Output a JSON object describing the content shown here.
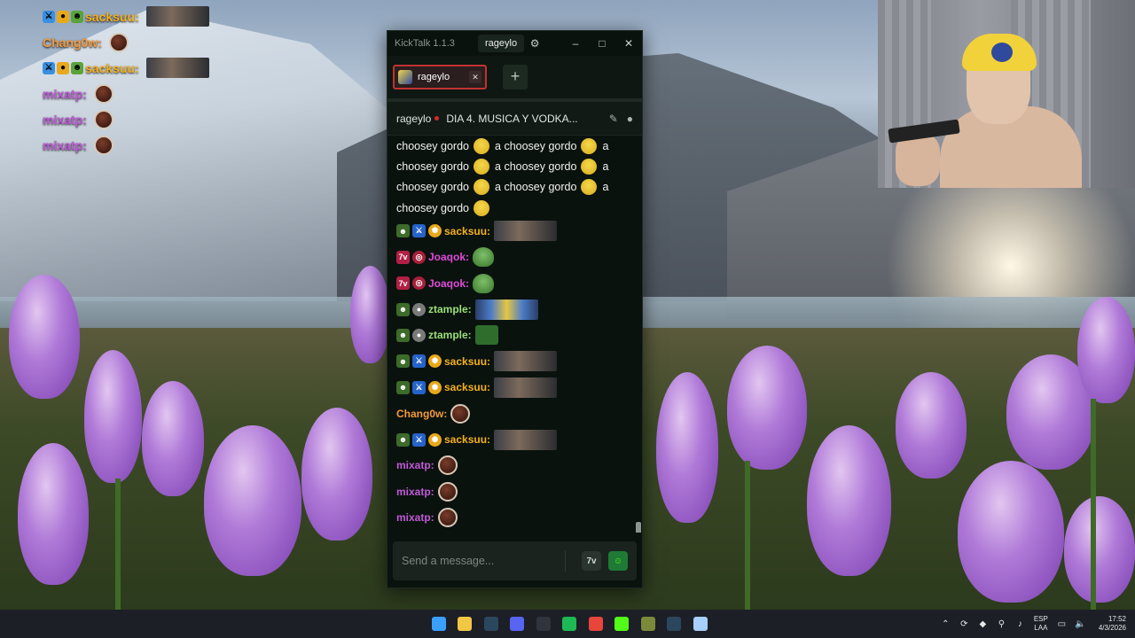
{
  "overlay_chat": [
    {
      "user": "sacksuu:",
      "color": "#f5b11c",
      "badges": [
        "sword",
        "coin",
        "robot"
      ],
      "emote": "image"
    },
    {
      "user": "Chang0w:",
      "color": "#f39a3b",
      "badges": [],
      "emote": "ball"
    },
    {
      "user": "sacksuu:",
      "color": "#f5b11c",
      "badges": [
        "sword",
        "coin",
        "robot"
      ],
      "emote": "image"
    },
    {
      "user": "mixatp:",
      "color": "#c05ad8",
      "badges": [],
      "emote": "ball"
    },
    {
      "user": "mixatp:",
      "color": "#c05ad8",
      "badges": [],
      "emote": "ball"
    },
    {
      "user": "mixatp:",
      "color": "#c05ad8",
      "badges": [],
      "emote": "ball"
    }
  ],
  "window": {
    "app_title": "KickTalk 1.1.3",
    "current_user": "rageylo",
    "settings_icon": "gear-icon",
    "minimize": "–",
    "maximize": "□",
    "close": "✕"
  },
  "tabs": [
    {
      "label": "rageylo",
      "close": "✕"
    }
  ],
  "add_tab_label": "+",
  "chat_header": {
    "channel": "rageylo",
    "stream_title": "DIA 4. MUSICA Y VODKA...",
    "icons": [
      "pin-icon",
      "user-icon"
    ]
  },
  "repeated_message": {
    "lines": [
      [
        "choosey gordo",
        "a choosey gordo",
        "a"
      ],
      [
        "choosey gordo",
        "a choosey gordo",
        "a"
      ],
      [
        "choosey gordo",
        "a choosey gordo",
        "a"
      ],
      [
        "choosey gordo"
      ]
    ]
  },
  "messages": [
    {
      "user": "sacksuu:",
      "color": "#f5b11c",
      "badges": [
        "green",
        "blue",
        "gold"
      ],
      "emote": "image"
    },
    {
      "user": "Joaqok:",
      "color": "#e04ad8",
      "badges": [
        "red",
        "pink"
      ],
      "emote": "frog"
    },
    {
      "user": "Joaqok:",
      "color": "#e04ad8",
      "badges": [
        "red",
        "pink"
      ],
      "emote": "frog"
    },
    {
      "user": "ztample:",
      "color": "#9be07a",
      "badges": [
        "green",
        "gray"
      ],
      "emote": "minions"
    },
    {
      "user": "ztample:",
      "color": "#9be07a",
      "badges": [
        "green",
        "gray"
      ],
      "emote": "box"
    },
    {
      "user": "sacksuu:",
      "color": "#f5b11c",
      "badges": [
        "green",
        "blue",
        "gold"
      ],
      "emote": "image"
    },
    {
      "user": "sacksuu:",
      "color": "#f5b11c",
      "badges": [
        "green",
        "blue",
        "gold"
      ],
      "emote": "image"
    },
    {
      "user": "Chang0w:",
      "color": "#f39a3b",
      "badges": [],
      "emote": "ball"
    },
    {
      "user": "sacksuu:",
      "color": "#f5b11c",
      "badges": [
        "green",
        "blue",
        "gold"
      ],
      "emote": "image"
    },
    {
      "user": "mixatp:",
      "color": "#c05ad8",
      "badges": [],
      "emote": "ball"
    },
    {
      "user": "mixatp:",
      "color": "#c05ad8",
      "badges": [],
      "emote": "ball"
    },
    {
      "user": "mixatp:",
      "color": "#c05ad8",
      "badges": [],
      "emote": "ball"
    }
  ],
  "input": {
    "placeholder": "Send a message...",
    "value": "",
    "seventv_button": "7v",
    "kick_emote_button": "kick-emote-icon"
  },
  "taskbar": {
    "apps": [
      {
        "name": "windows-start-icon",
        "color": "#3aa0ff"
      },
      {
        "name": "file-explorer-icon",
        "color": "#f2c744"
      },
      {
        "name": "steam-icon",
        "color": "#2a475e"
      },
      {
        "name": "discord-icon",
        "color": "#5865f2"
      },
      {
        "name": "obs-icon",
        "color": "#30343c"
      },
      {
        "name": "spotify-icon",
        "color": "#1db954"
      },
      {
        "name": "chrome-icon",
        "color": "#e8453c"
      },
      {
        "name": "kick-icon",
        "color": "#53fc18"
      },
      {
        "name": "kicktalk-icon",
        "color": "#7a8a3a"
      },
      {
        "name": "steam-icon-2",
        "color": "#2a475e"
      },
      {
        "name": "notepad-icon",
        "color": "#a7d0ff"
      }
    ],
    "tray_icons": [
      "chevron-up-icon",
      "sync-icon",
      "defender-icon",
      "usb-icon",
      "mic-icon"
    ],
    "language": [
      "ESP",
      "LAA"
    ],
    "tray_icons_2": [
      "monitor-icon",
      "volume-icon"
    ],
    "time": "17:52",
    "date": "4/3/2026"
  }
}
